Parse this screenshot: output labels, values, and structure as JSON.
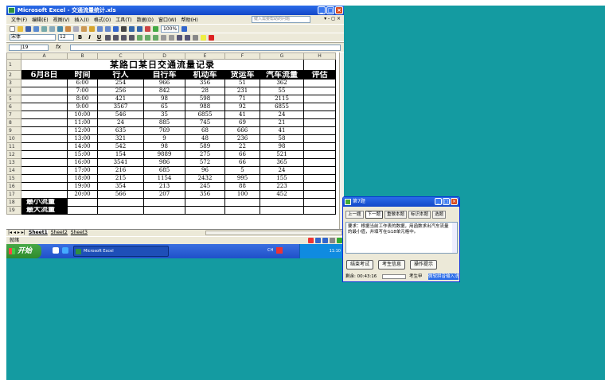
{
  "window": {
    "title": "Microsoft Excel - 交通流量统计.xls"
  },
  "menu": [
    "文件(F)",
    "编辑(E)",
    "视图(V)",
    "插入(I)",
    "格式(O)",
    "工具(T)",
    "数据(D)",
    "窗口(W)",
    "帮助(H)"
  ],
  "help_placeholder": "键入需要帮助的问题",
  "toolbar": {
    "font_name": "宋体",
    "font_size": "12",
    "bold": "B",
    "italic": "I",
    "underline": "U",
    "zoom": "100%"
  },
  "formula": {
    "name_box": "J19",
    "fx": "fx"
  },
  "columns": [
    "A",
    "B",
    "C",
    "D",
    "E",
    "F",
    "G",
    "H"
  ],
  "sheet": {
    "title": "某路口某日交通流量记录",
    "date": "6月8日",
    "headers": [
      "时间",
      "行人",
      "自行车",
      "机动车",
      "货运车",
      "汽车流量",
      "评估"
    ],
    "rows": [
      [
        "6:00",
        "254",
        "966",
        "356",
        "51",
        "362",
        ""
      ],
      [
        "7:00",
        "256",
        "842",
        "28",
        "231",
        "55",
        ""
      ],
      [
        "8:00",
        "421",
        "98",
        "598",
        "71",
        "2115",
        ""
      ],
      [
        "9:00",
        "3567",
        "65",
        "988",
        "92",
        "6855",
        ""
      ],
      [
        "10:00",
        "546",
        "35",
        "6855",
        "41",
        "24",
        ""
      ],
      [
        "11:00",
        "24",
        "885",
        "745",
        "69",
        "21",
        ""
      ],
      [
        "12:00",
        "635",
        "769",
        "68",
        "666",
        "41",
        ""
      ],
      [
        "13:00",
        "321",
        "9",
        "48",
        "236",
        "58",
        ""
      ],
      [
        "14:00",
        "542",
        "98",
        "589",
        "22",
        "98",
        ""
      ],
      [
        "15:00",
        "154",
        "9889",
        "275",
        "66",
        "521",
        ""
      ],
      [
        "16:00",
        "3541",
        "986",
        "572",
        "66",
        "365",
        ""
      ],
      [
        "17:00",
        "216",
        "685",
        "96",
        "5",
        "24",
        ""
      ],
      [
        "18:00",
        "215",
        "1154",
        "2432",
        "995",
        "155",
        ""
      ],
      [
        "19:00",
        "354",
        "213",
        "245",
        "88",
        "223",
        ""
      ],
      [
        "20:00",
        "566",
        "207",
        "356",
        "100",
        "452",
        ""
      ]
    ],
    "min_label": "最小流量",
    "max_label": "最大流量"
  },
  "sheet_tabs": [
    "Sheet1",
    "Sheet2",
    "Sheet3"
  ],
  "status": "就绪",
  "taskbar": {
    "start": "开始",
    "task": "Microsoft Excel",
    "clock": "11:10",
    "tray_label": "CH"
  },
  "exam": {
    "title": "第7题",
    "tabs": [
      "上一题",
      "下一题",
      "重做本题",
      "标识本题",
      "选题"
    ],
    "question": "要求：根据当前工作表的数据，用函数求出汽车流量的最小值，并填写在G18单元格中。",
    "buttons": [
      "结束考试",
      "考生信息",
      "操作提示"
    ],
    "timer": "剩余: 00:43:16",
    "student_label": "考生甲",
    "ime": "微软拼音输入法"
  }
}
